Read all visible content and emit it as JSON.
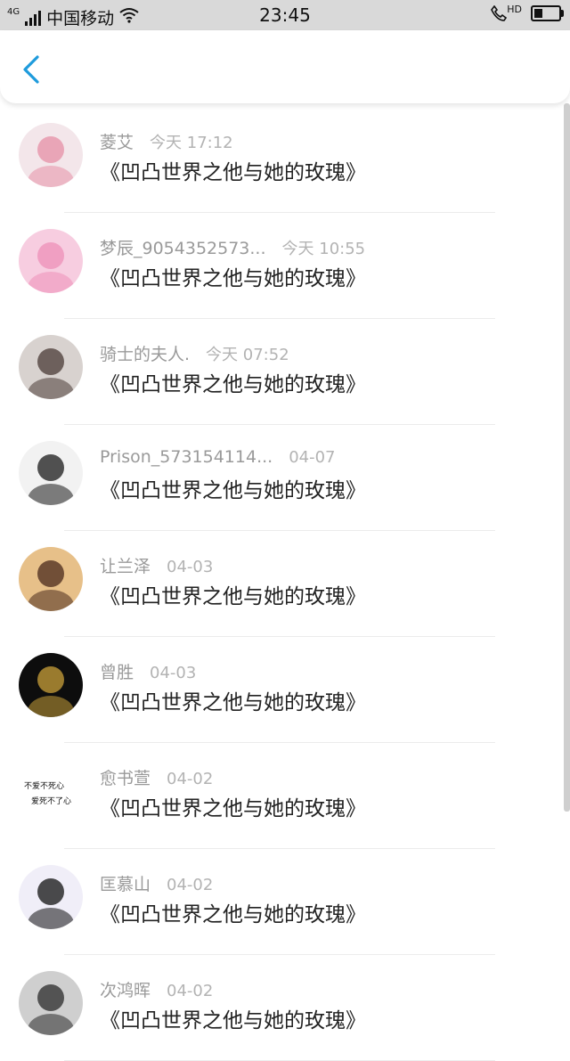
{
  "status_bar": {
    "carrier": "中国移动",
    "network": "4G",
    "time": "23:45",
    "hd_label": "HD",
    "battery_level": 0.35
  },
  "nav": {
    "back_icon": "chevron-left-icon",
    "accent_color": "#1e9bdc"
  },
  "comments": [
    {
      "name": "菱艾",
      "time": "今天 17:12",
      "title": "《凹凸世界之他与她的玫瑰》",
      "avatar_color": "#f3e6ea",
      "avatar_accent": "#e58fa6"
    },
    {
      "name": "梦辰_9054352573...",
      "time": "今天 10:55",
      "title": "《凹凸世界之他与她的玫瑰》",
      "avatar_color": "#f7cde0",
      "avatar_accent": "#ee8fb8"
    },
    {
      "name": "骑士的夫人.",
      "time": "今天 07:52",
      "title": "《凹凸世界之他与她的玫瑰》",
      "avatar_color": "#d8d2cf",
      "avatar_accent": "#4a3a36"
    },
    {
      "name": "Prison_573154114...",
      "time": "04-07",
      "title": "《凹凸世界之他与她的玫瑰》",
      "avatar_color": "#f2f2f2",
      "avatar_accent": "#1a1a1a"
    },
    {
      "name": "让兰泽",
      "time": "04-03",
      "title": "《凹凸世界之他与她的玫瑰》",
      "avatar_color": "#e7c089",
      "avatar_accent": "#4a2a1c"
    },
    {
      "name": "曾胜",
      "time": "04-03",
      "title": "《凹凸世界之他与她的玫瑰》",
      "avatar_color": "#0d0d0d",
      "avatar_accent": "#c9a03a"
    },
    {
      "name": "愈书萱",
      "time": "04-02",
      "title": "《凹凸世界之他与她的玫瑰》",
      "avatar_color": "#ffffff",
      "avatar_accent": "#111111",
      "avatar_text_1": "不爱不死心",
      "avatar_text_2": "爱死不了心"
    },
    {
      "name": "匡慕山",
      "time": "04-02",
      "title": "《凹凸世界之他与她的玫瑰》",
      "avatar_color": "#f0eef8",
      "avatar_accent": "#111111"
    },
    {
      "name": "次鸿晖",
      "time": "04-02",
      "title": "《凹凸世界之他与她的玫瑰》",
      "avatar_color": "#cfcfcf",
      "avatar_accent": "#2a2a2a"
    }
  ]
}
